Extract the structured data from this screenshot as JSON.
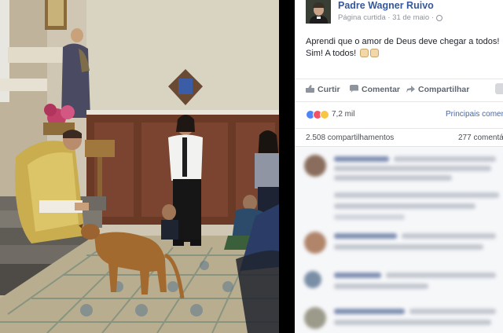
{
  "post": {
    "author": "Padre Wagner Ruivo",
    "meta": "Página curtida · 31 de maio ·",
    "text_line1": "Aprendi que o amor de Deus deve chegar a todos!",
    "text_line2": "Sim! A todos!",
    "actions": {
      "like": "Curtir",
      "comment": "Comentar",
      "share": "Compartilhar"
    },
    "reactions_count": "7,2 mil",
    "top_comments": "Principais comentário",
    "shares": "2.508 compartilhamentos",
    "comments_count": "277 comentá"
  },
  "colors": {
    "link_blue": "#365899",
    "meta_gray": "#90949c",
    "like_blue": "#4d84f7",
    "love_red": "#f25268",
    "wow_yellow": "#f7c644"
  },
  "icons": [
    "like-icon",
    "comment-icon",
    "share-icon",
    "globe-icon",
    "more-options-icon"
  ]
}
